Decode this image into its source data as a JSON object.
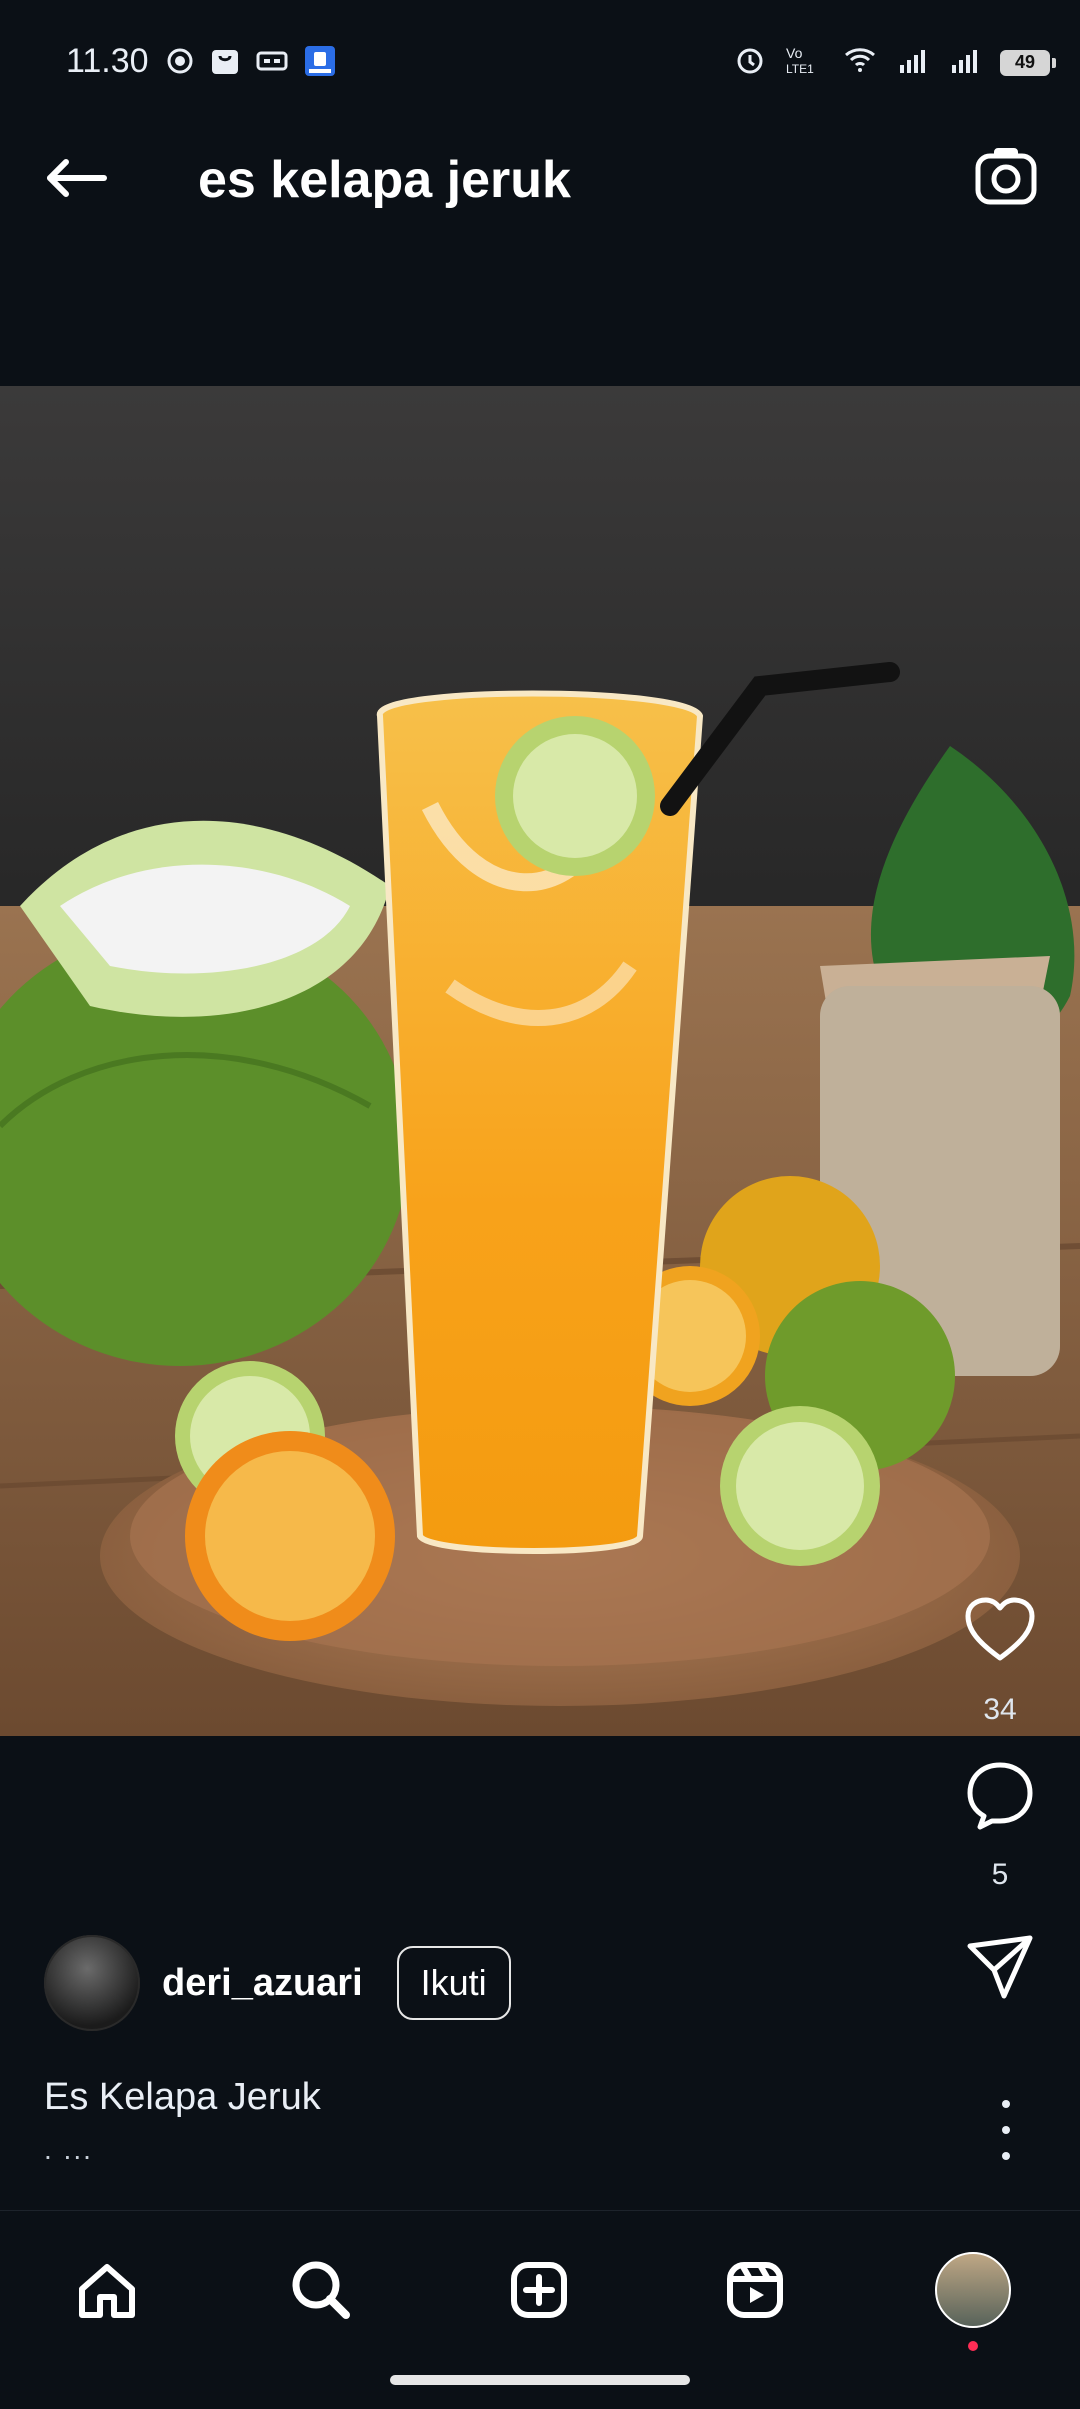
{
  "status": {
    "time": "11.30",
    "battery": "49"
  },
  "header": {
    "title": "es kelapa jeruk"
  },
  "post": {
    "likes": "34",
    "comments": "5",
    "username": "deri_azuari",
    "follow_label": "Ikuti",
    "caption": "Es Kelapa Jeruk",
    "caption_more": ". ..."
  },
  "icons": {
    "back": "arrow-left-icon",
    "camera": "camera-icon",
    "like": "heart-icon",
    "comment": "comment-icon",
    "share": "send-icon",
    "more": "more-vertical-icon",
    "home": "home-icon",
    "search": "search-icon",
    "create": "add-square-icon",
    "reels": "reels-icon",
    "profile": "profile-avatar-icon"
  },
  "colors": {
    "background": "#0b1016",
    "text": "#ffffff",
    "accent_dot": "#ff2d55"
  }
}
